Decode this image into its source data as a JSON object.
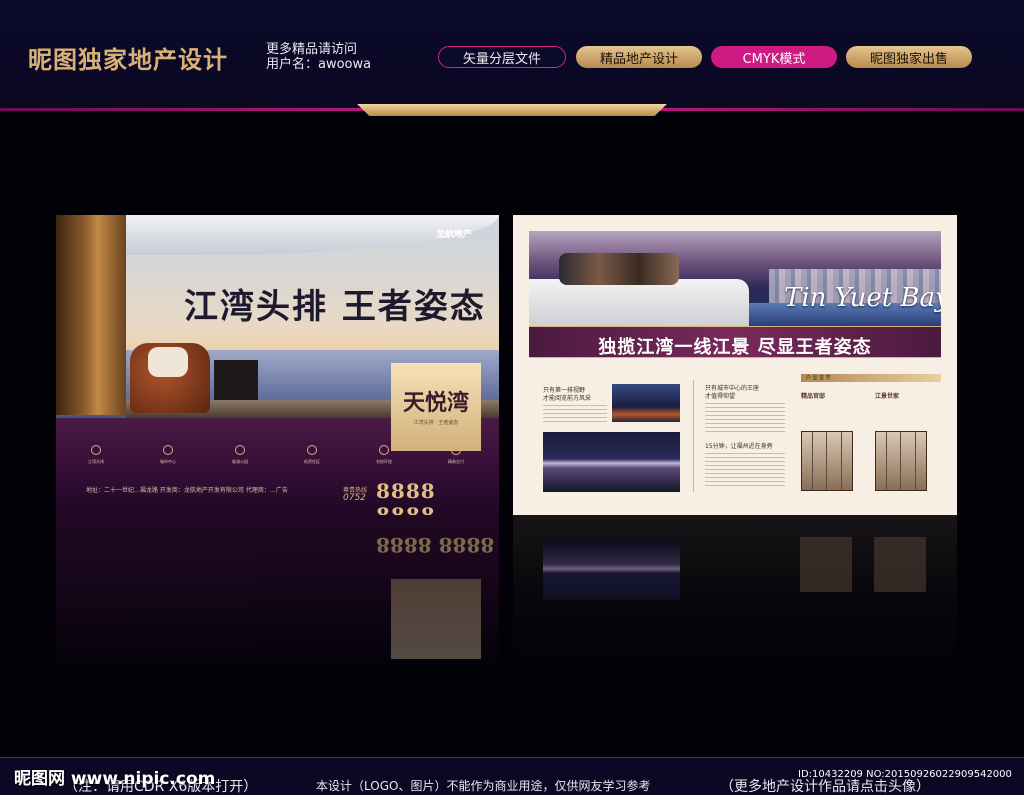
{
  "header": {
    "brand": "昵图独家地产设计",
    "more_line_1": "更多精品请访问",
    "more_line_2": "用户名：awoowa",
    "tags": [
      "矢量分层文件",
      "精品地产设计",
      "CMYK模式",
      "昵图独家出售"
    ],
    "colors": {
      "magenta": "#c0187c",
      "gold": "#d9b177",
      "navy": "#0b0a2a"
    }
  },
  "left_board": {
    "slogan": "江湾头排  王者姿态",
    "developer": "龙航地产",
    "project_name": "天悦湾",
    "project_sub": "江湾头排 · 王者姿态",
    "features": [
      "江湾头排",
      "城市中心",
      "临湖公园",
      "低密住区",
      "名校环绕",
      "精装交付"
    ],
    "address": "地址：二十一世纪…福龙路  开发商：龙航地产开发有限公司  代理商：…广告",
    "area_code": "0752",
    "phone": "8888 8888",
    "phone_label": "尊贵热线"
  },
  "right_board": {
    "english_name": "Tin Yuet Bay",
    "slogan": "独揽江湾一线江景  尽显王者姿态",
    "col1_title_1": "只有第一排视野",
    "col1_title_2": "才能阅览前方风采",
    "col2_title_1": "只有城市中心的王座",
    "col2_title_2": "才值得仰望",
    "col2_title_3": "15分钟，让福州近在身旁",
    "floorplan_header": "户 型 鉴 赏",
    "plan_1_label": "精品官邸",
    "plan_2_label": "江景世家"
  },
  "footer": {
    "note": "（注：请用CDR X6版本打开）",
    "disclaimer": "本设计（LOGO、图片）不能作为商业用途，仅供网友学习参考",
    "more": "（更多地产设计作品请点击头像）",
    "watermark_site": "昵图网 www.nipic.com",
    "watermark_id": "ID:10432209 NO:20150926022909542000"
  }
}
